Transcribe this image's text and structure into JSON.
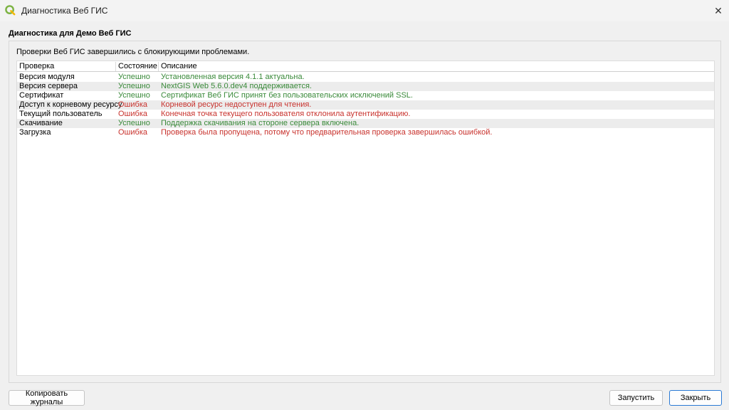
{
  "window": {
    "title": "Диагностика Веб ГИС",
    "close_icon": "close-icon"
  },
  "heading": "Диагностика для Демо Веб ГИС",
  "summary": "Проверки Веб ГИС завершились с блокирующими проблемами.",
  "colors": {
    "success": "#3a8a3a",
    "error": "#c8322d"
  },
  "table": {
    "headers": [
      "Проверка",
      "Состояние",
      "Описание"
    ],
    "rows": [
      {
        "check": "Версия модуля",
        "status": "Успешно",
        "status_type": "success",
        "description": "Установленная версия 4.1.1 актуальна."
      },
      {
        "check": "Версия сервера",
        "status": "Успешно",
        "status_type": "success",
        "description": "NextGIS Web 5.6.0.dev4 поддерживается."
      },
      {
        "check": "Сертификат",
        "status": "Успешно",
        "status_type": "success",
        "description": "Сертификат Веб ГИС принят без пользовательских исключений SSL."
      },
      {
        "check": "Доступ к корневому ресурсу",
        "status": "Ошибка",
        "status_type": "error",
        "description": "Корневой ресурс недоступен для чтения."
      },
      {
        "check": "Текущий пользователь",
        "status": "Ошибка",
        "status_type": "error",
        "description": "Конечная точка текущего пользователя отклонила аутентификацию."
      },
      {
        "check": "Скачивание",
        "status": "Успешно",
        "status_type": "success",
        "description": "Поддержка скачивания на стороне сервера включена."
      },
      {
        "check": "Загрузка",
        "status": "Ошибка",
        "status_type": "error",
        "description": "Проверка была пропущена, потому что предварительная проверка завершилась ошибкой."
      }
    ]
  },
  "buttons": {
    "copy_logs": "Копировать журналы",
    "run": "Запустить",
    "close": "Закрыть"
  }
}
